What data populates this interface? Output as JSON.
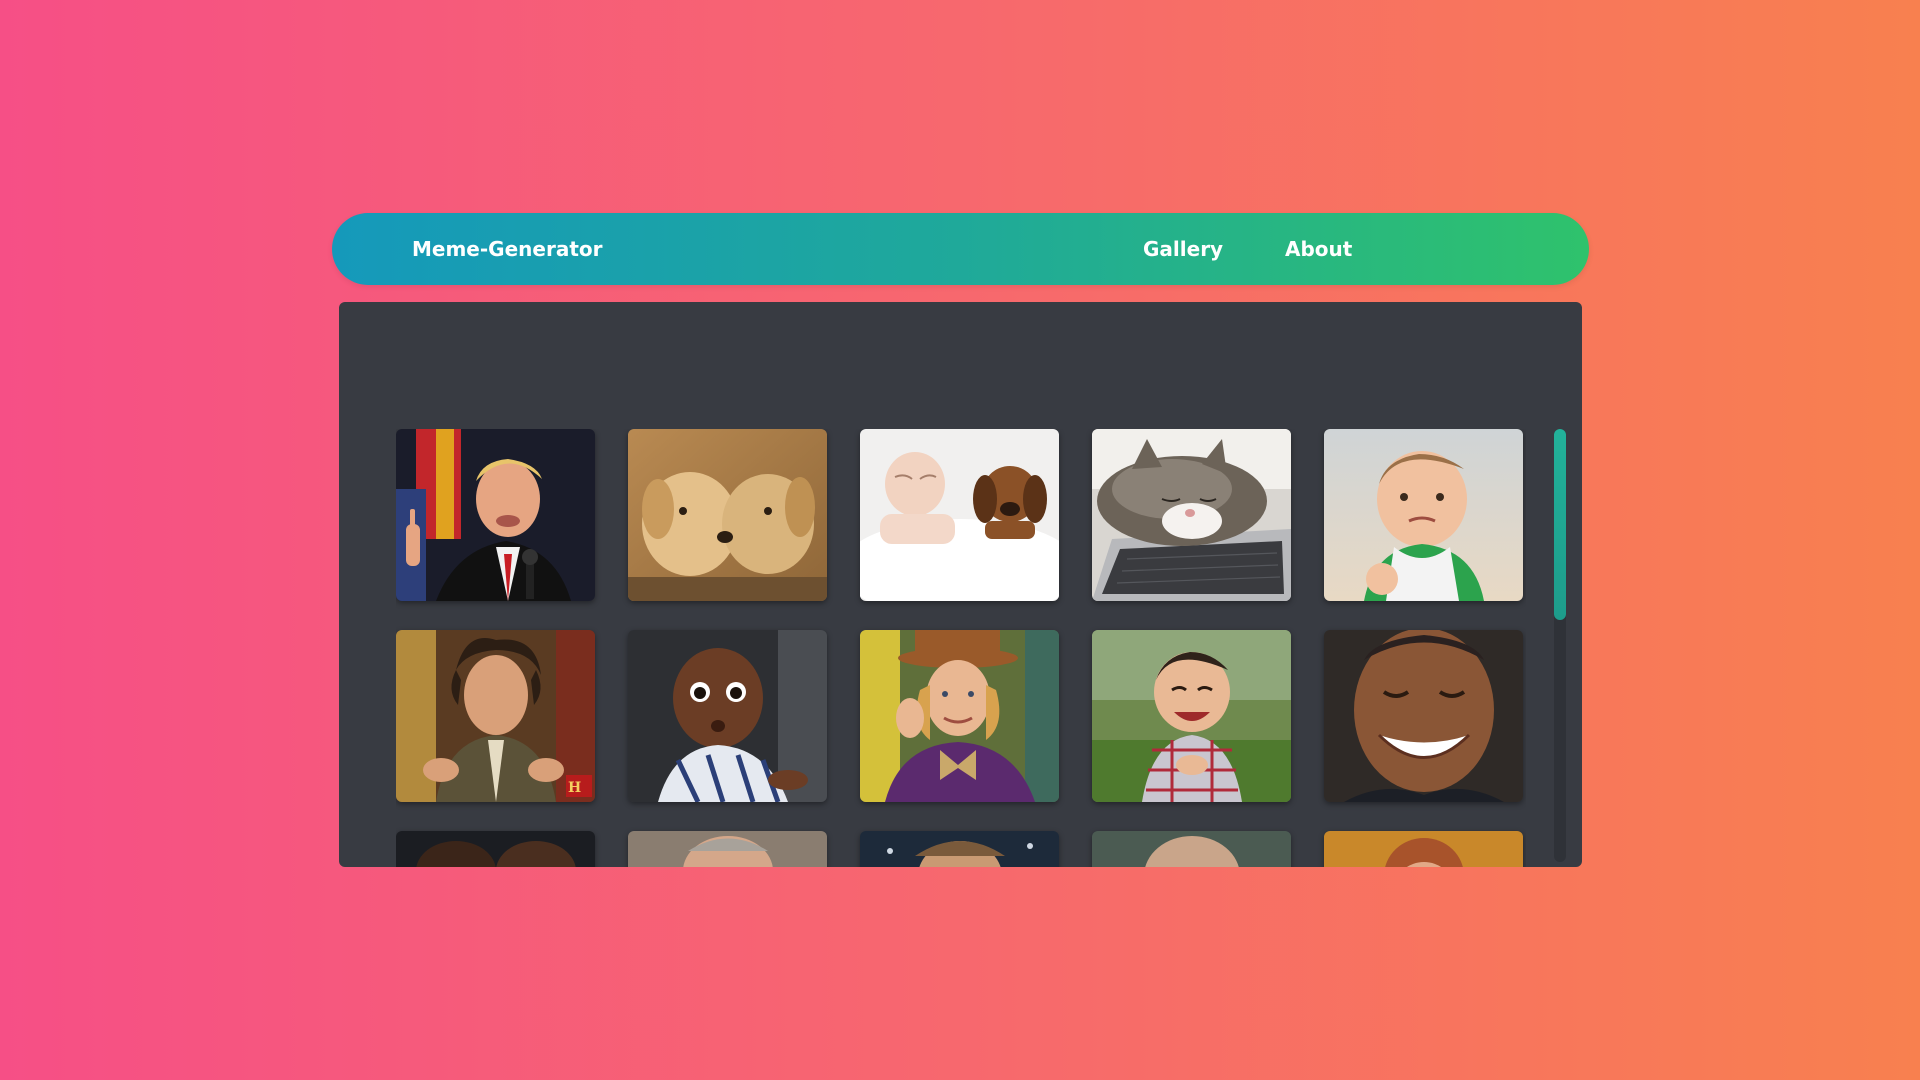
{
  "navbar": {
    "brand": "Meme-Generator",
    "links": [
      {
        "label": "Gallery"
      },
      {
        "label": "About"
      }
    ]
  },
  "gallery": {
    "scroll_fraction_visible": 0.44,
    "thumbnails": [
      {
        "name": "meme-thumb-speaker-finger-raised"
      },
      {
        "name": "meme-thumb-puppies-kissing"
      },
      {
        "name": "meme-thumb-baby-and-dog-sleeping"
      },
      {
        "name": "meme-thumb-cat-sleeping-on-laptop"
      },
      {
        "name": "meme-thumb-success-kid"
      },
      {
        "name": "meme-thumb-ancient-aliens-guy"
      },
      {
        "name": "meme-thumb-surprised-baby"
      },
      {
        "name": "meme-thumb-condescending-wonka"
      },
      {
        "name": "meme-thumb-evil-toddler"
      },
      {
        "name": "meme-thumb-laughing-man"
      },
      {
        "name": "meme-thumb-row3-1"
      },
      {
        "name": "meme-thumb-row3-2"
      },
      {
        "name": "meme-thumb-row3-3"
      },
      {
        "name": "meme-thumb-row3-4"
      },
      {
        "name": "meme-thumb-row3-5"
      }
    ]
  }
}
